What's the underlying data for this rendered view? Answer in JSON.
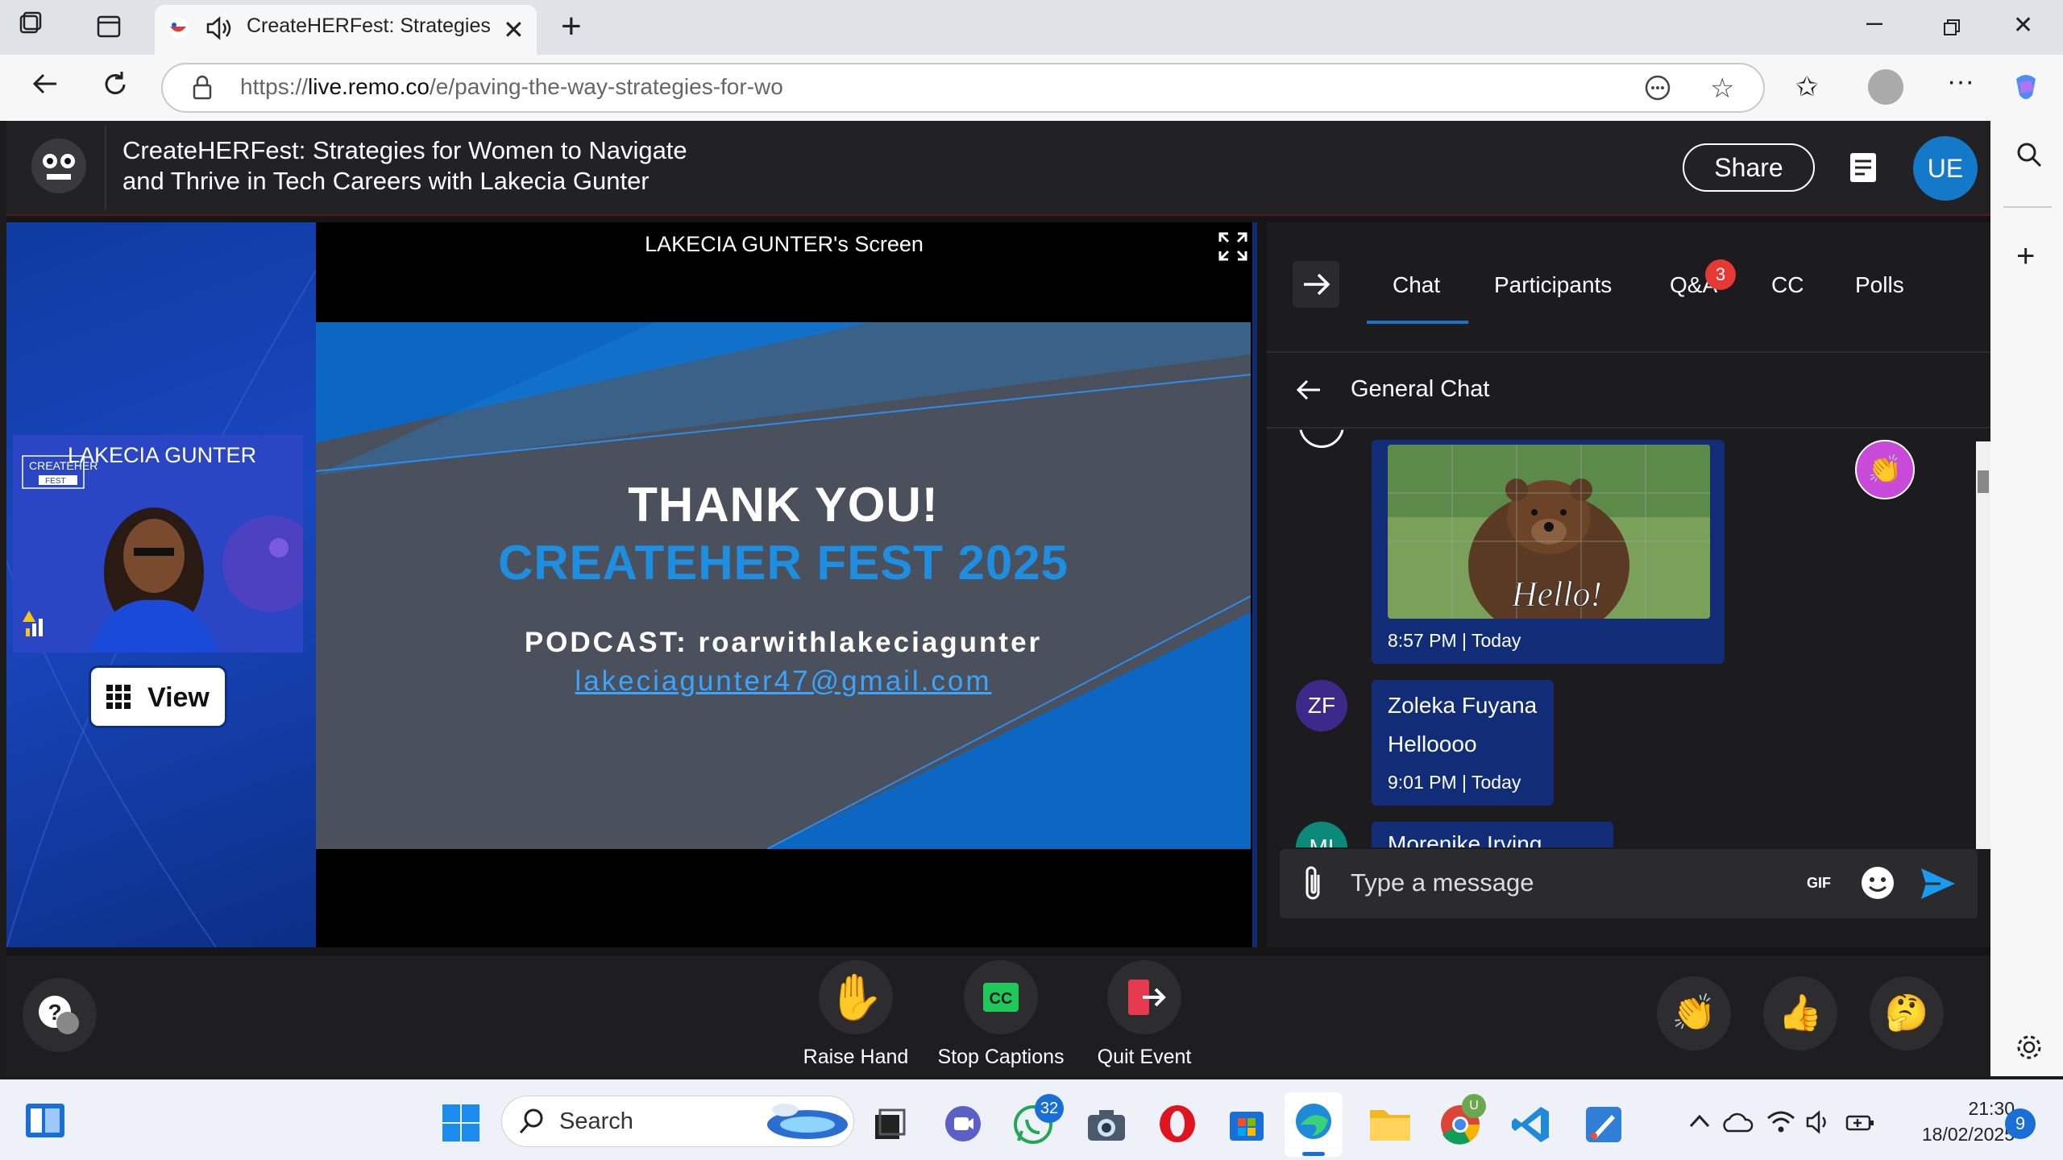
{
  "browser": {
    "tab_title": "CreateHERFest: Strategies fo",
    "url_prefix": "https://",
    "url_host": "live.remo.co",
    "url_path": "/e/paving-the-way-strategies-for-wo"
  },
  "header": {
    "event_title_line1": "CreateHERFest: Strategies for Women to Navigate",
    "event_title_line2": "and Thrive in Tech Careers with Lakecia Gunter",
    "share_label": "Share",
    "user_initials": "UE",
    "user_avatar_color": "#1479c8"
  },
  "stage": {
    "speaker_name": "LAKECIA GUNTER",
    "view_label": "View",
    "screen_label": "LAKECIA GUNTER's Screen",
    "slide": {
      "line1": "THANK YOU!",
      "line2": "CREATEHER FEST 2025",
      "line3": "PODCAST: roarwithlakeciagunter",
      "line4": "lakeciagunter47@gmail.com"
    }
  },
  "panel": {
    "tabs": [
      "Chat",
      "Participants",
      "Q&A",
      "CC",
      "Polls"
    ],
    "active_tab": "Chat",
    "qa_badge": "3",
    "chat_title": "General Chat",
    "messages": [
      {
        "gif_caption": "Hello!",
        "time": "8:57 PM | Today"
      },
      {
        "initials": "ZF",
        "name": "Zoleka Fuyana",
        "text": "Helloooo",
        "time": "9:01 PM | Today"
      },
      {
        "initials": "MI",
        "name": "Morenike Irving"
      }
    ],
    "input_placeholder": "Type a message",
    "gif_label": "GIF"
  },
  "controls": {
    "raise_hand": "Raise Hand",
    "stop_captions": "Stop Captions",
    "quit_event": "Quit Event"
  },
  "taskbar": {
    "search_label": "Search",
    "whatsapp_badge": "32",
    "chrome_badge": "U",
    "time": "21:30",
    "date": "18/02/2025",
    "notifications": "9"
  }
}
